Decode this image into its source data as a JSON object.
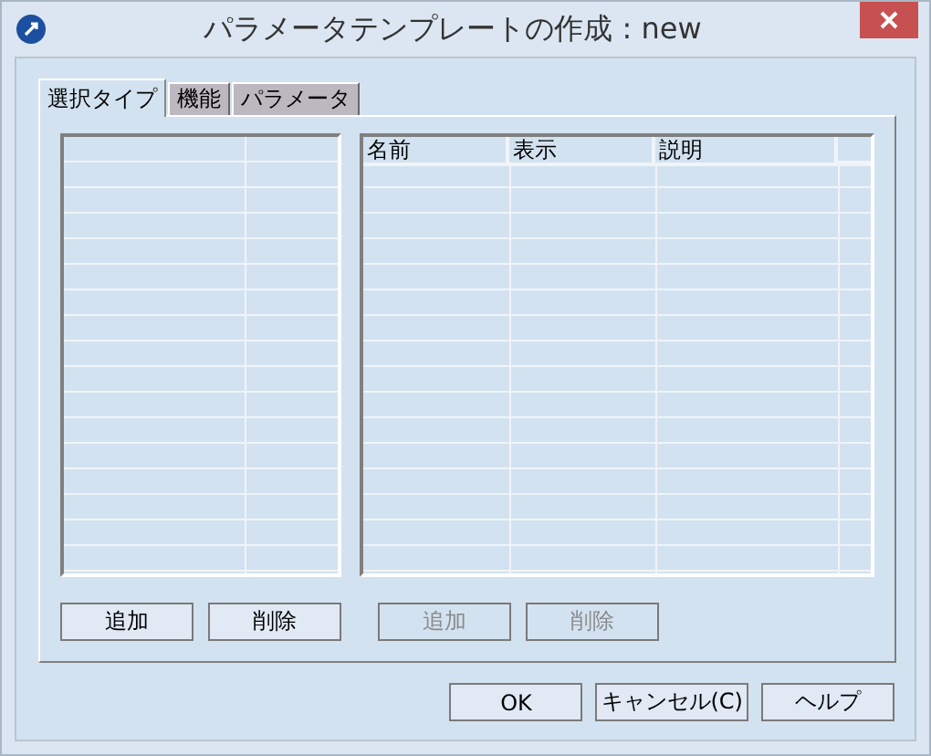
{
  "window": {
    "title": "パラメータテンプレートの作成 : new"
  },
  "tabs": [
    {
      "label": "選択タイプ",
      "selected": true
    },
    {
      "label": "機能",
      "selected": false
    },
    {
      "label": "パラメータ",
      "selected": false
    }
  ],
  "left_buttons": [
    {
      "label": "追加",
      "disabled": false
    },
    {
      "label": "削除",
      "disabled": false
    }
  ],
  "table": {
    "columns": [
      "名前",
      "表示",
      "説明"
    ]
  },
  "right_buttons": [
    {
      "label": "追加",
      "disabled": true
    },
    {
      "label": "削除",
      "disabled": true
    }
  ],
  "dialog_buttons": [
    {
      "label": "OK"
    },
    {
      "label": "キャンセル(C)"
    },
    {
      "label": "ヘルプ"
    }
  ]
}
